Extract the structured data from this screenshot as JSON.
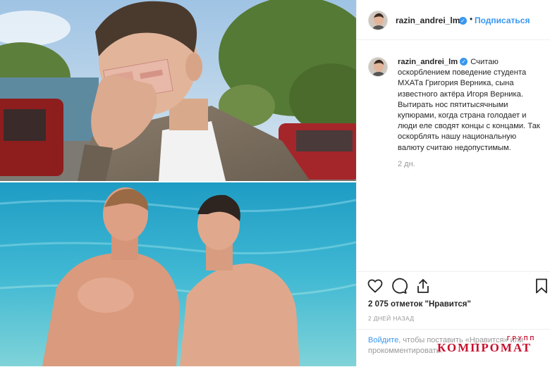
{
  "post": {
    "username": "razin_andrei_lm",
    "follow_label": "Подписаться",
    "separator": "•",
    "verified_glyph": "✓",
    "caption": "Считаю оскорблением поведение студента МХАТа Григория Верника, сына известного актёра Игоря Верника. Вытирать нос пятитысячными купюрами, когда страна голодает и люди еле сводят концы с концами. Так оскорблять нашу национальную валюту считаю недопустимым.",
    "time_ago": "2 дн.",
    "likes": "2 075 отметок \"Нравится\"",
    "date": "2 ДНЕЙ НАЗАД",
    "login_link": "Войдите",
    "login_rest": ", чтобы поставить «Нравится» или прокомментировать."
  },
  "watermark": {
    "small": "ГРУПП",
    "big": "КОМПРОМАТ"
  },
  "icons": {
    "like": "heart-icon",
    "comment": "comment-icon",
    "share": "share-icon",
    "save": "bookmark-icon",
    "verified": "verified-badge-icon"
  },
  "colors": {
    "link": "#3897f0",
    "verified": "#3897f0",
    "watermark": "#c8102e",
    "muted": "#999999"
  }
}
